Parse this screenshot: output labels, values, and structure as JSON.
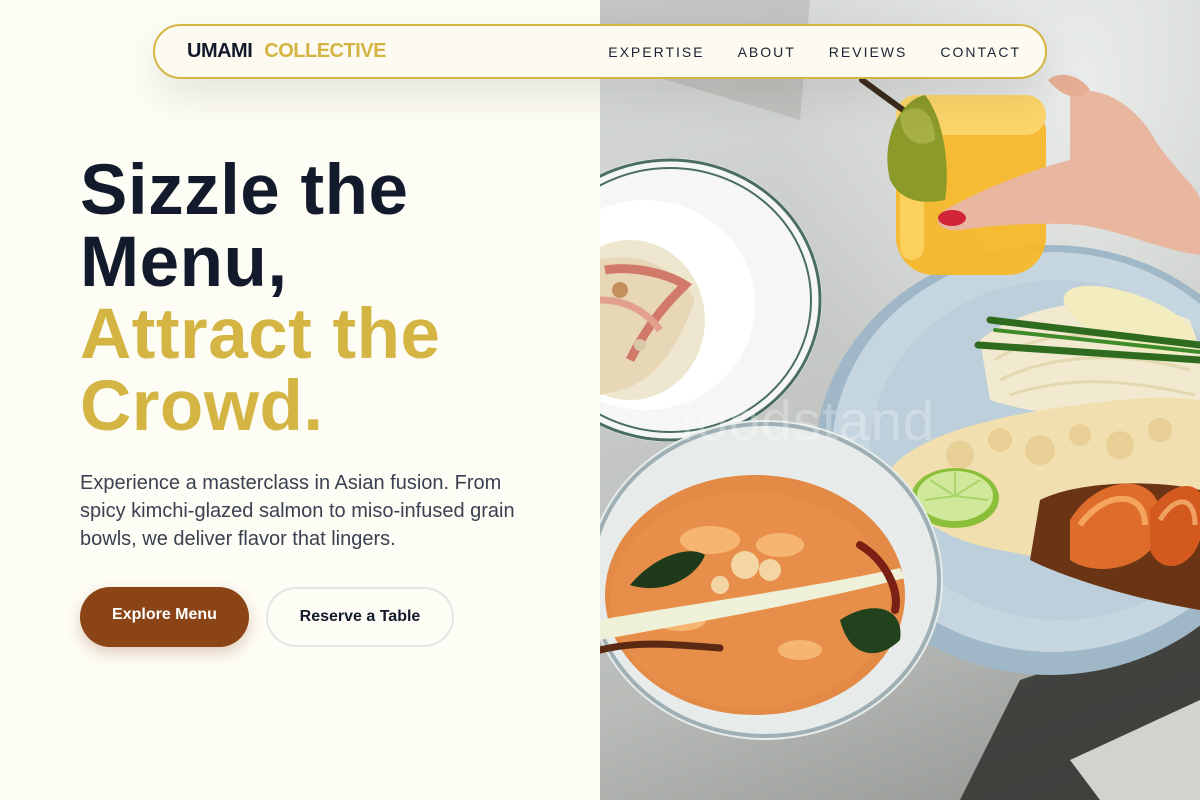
{
  "brand": {
    "name": "UMAMI",
    "accent": "COLLECTIVE"
  },
  "nav": {
    "links": [
      {
        "label": "EXPERTISE"
      },
      {
        "label": "ABOUT"
      },
      {
        "label": "REVIEWS"
      },
      {
        "label": "CONTACT"
      }
    ]
  },
  "hero": {
    "headline_line1": "Sizzle the",
    "headline_line2": "Menu,",
    "headline_line3": "Attract the",
    "headline_line4": "Crowd.",
    "lead": "Experience a masterclass in Asian fusion. From spicy kimchi-glazed salmon to miso-infused grain bowls, we deliver flavor that lingers.",
    "primary_cta": "Explore Menu",
    "secondary_cta": "Reserve a Table"
  },
  "photo": {
    "watermark": "foodstand"
  },
  "colors": {
    "accent_gold": "#d4b544",
    "primary_brown": "#8a4416",
    "ink": "#131a2b",
    "background": "#fdfcf5"
  },
  "icons": [
    "food-photo"
  ]
}
